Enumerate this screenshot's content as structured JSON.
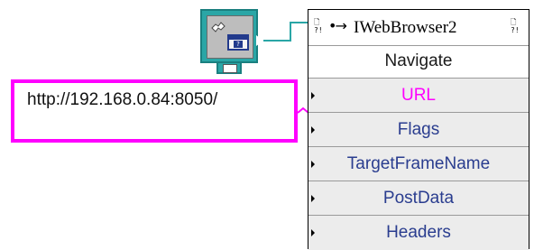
{
  "string_constant": {
    "value": "http://192.168.0.84:8050/"
  },
  "invoke_node": {
    "class_name": "IWebBrowser2",
    "method": "Navigate",
    "parameters": [
      {
        "label": "URL",
        "color": "#ff00ff",
        "wired": true
      },
      {
        "label": "Flags",
        "color": "#2a3d8f",
        "wired": false
      },
      {
        "label": "TargetFrameName",
        "color": "#2a3d8f",
        "wired": false
      },
      {
        "label": "PostData",
        "color": "#2a3d8f",
        "wired": false
      },
      {
        "label": "Headers",
        "color": "#2a3d8f",
        "wired": false
      }
    ]
  },
  "colors": {
    "string_wire": "#ff00ff",
    "refnum_wire": "#2aa6a6",
    "activex_icon": "#2aa6a6",
    "param_background": "#ececec"
  },
  "icons": {
    "container": "activex-container-icon",
    "reference_in": "refnum-in-icon",
    "reference_out": "refnum-out-icon"
  }
}
